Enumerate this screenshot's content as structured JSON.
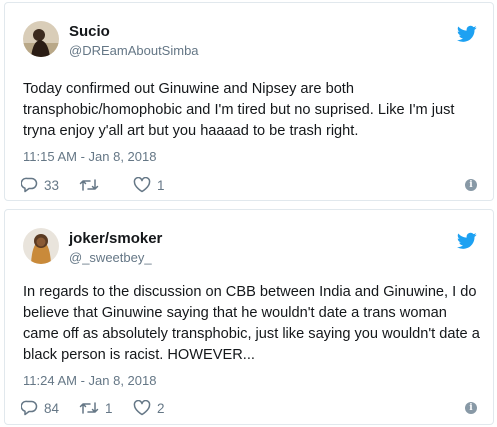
{
  "tweets": [
    {
      "display_name": "Sucio",
      "handle": "@DREamAboutSimba",
      "text": "Today confirmed out Ginuwine and Nipsey are both transphobic/homophobic and I'm tired but no suprised. Like I'm just tryna enjoy y'all art but you haaaad to be trash right.",
      "timestamp": "11:15 AM - Jan 8, 2018",
      "replies": "33",
      "retweets": "",
      "likes": "1"
    },
    {
      "display_name": "joker/smoker",
      "handle": "@_sweetbey_",
      "text": "In regards to the discussion on CBB between India and Ginuwine, I do believe that Ginuwine saying that he wouldn't date a trans woman came off as absolutely transphobic, just like saying you wouldn't date a black person is racist. HOWEVER...",
      "timestamp": "11:24 AM - Jan 8, 2018",
      "replies": "84",
      "retweets": "1",
      "likes": "2"
    }
  ],
  "icons": {
    "reply": "reply-icon",
    "retweet": "retweet-icon",
    "like": "heart-icon",
    "info": "info-icon",
    "brand": "twitter-bird-icon"
  },
  "colors": {
    "brand": "#1da1f2",
    "secondary_text": "#657786",
    "border": "#e1e8ed"
  },
  "info_glyph": "i"
}
